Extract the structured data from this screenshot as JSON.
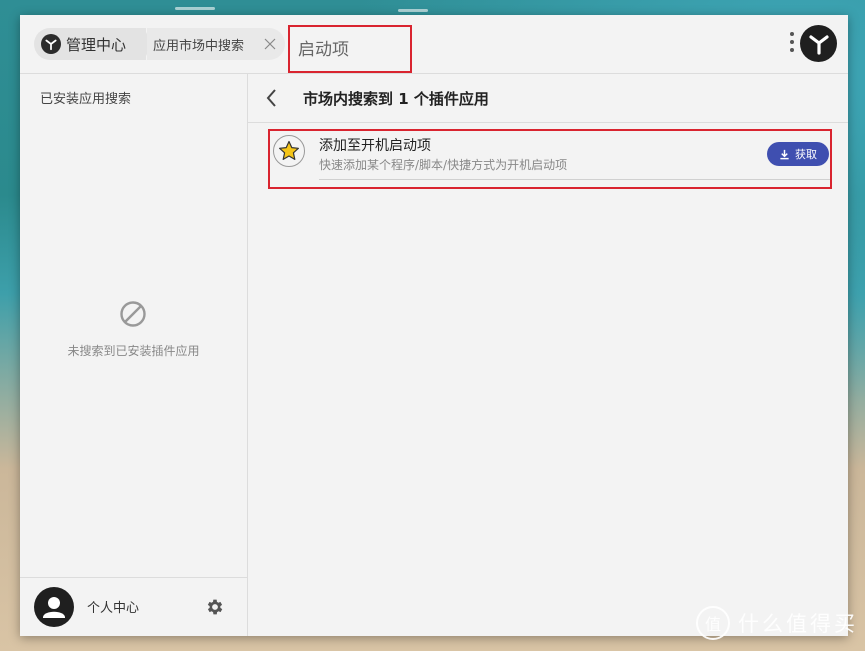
{
  "titlebar": {
    "home_label": "管理中心",
    "tab_label": "应用市场中搜索",
    "search_query": "启动项"
  },
  "sidebar": {
    "title": "已安装应用搜索",
    "empty_message": "未搜索到已安装插件应用",
    "footer_user_label": "个人中心"
  },
  "main": {
    "title": "市场内搜索到 1 个插件应用",
    "results": [
      {
        "title": "添加至开机启动项",
        "description": "快速添加某个程序/脚本/快捷方式为开机启动项",
        "action_label": "获取",
        "icon": "star-icon"
      }
    ]
  },
  "watermark": {
    "text": "什么值得买",
    "glyph": "值"
  },
  "colors": {
    "accent": "#3f4fb0",
    "highlight": "#d9242f",
    "star": "#f5c518"
  }
}
